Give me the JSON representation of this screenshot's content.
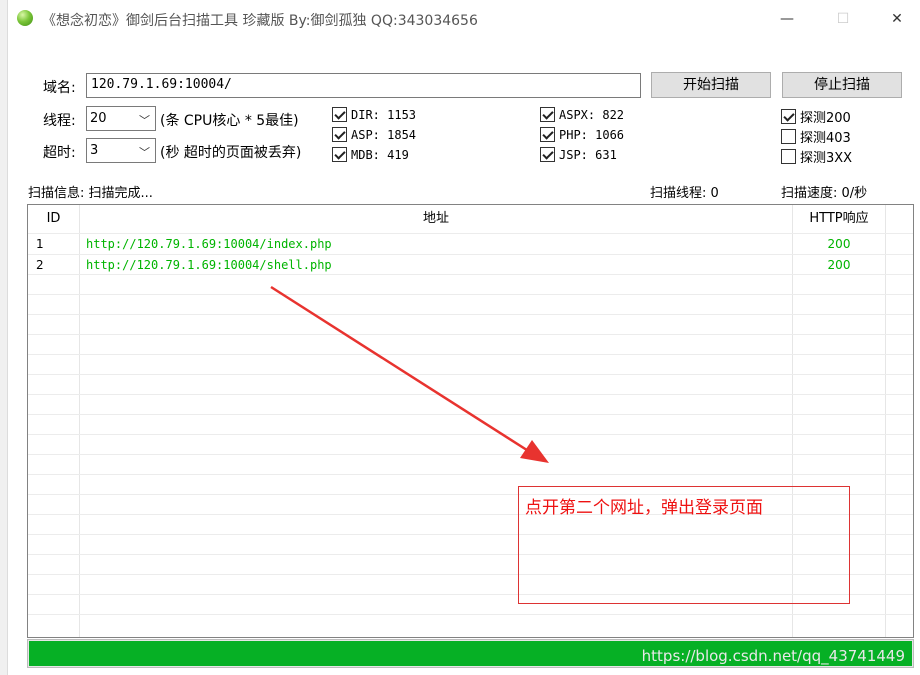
{
  "window": {
    "title": "《想念初恋》御剑后台扫描工具 珍藏版 By:御剑孤独 QQ:343034656",
    "minimize_glyph": "—",
    "maximize_glyph": "☐",
    "close_glyph": "✕"
  },
  "form": {
    "domain_label": "域名:",
    "domain_value": "120.79.1.69:10004/",
    "threads_label": "线程:",
    "threads_value": "20",
    "threads_hint": "(条 CPU核心 * 5最佳)",
    "timeout_label": "超时:",
    "timeout_value": "3",
    "timeout_hint": "(秒 超时的页面被丢弃)",
    "start_button": "开始扫描",
    "stop_button": "停止扫描"
  },
  "dictionaries": [
    {
      "label": "DIR: 1153",
      "checked": true
    },
    {
      "label": "ASP: 1854",
      "checked": true
    },
    {
      "label": "MDB: 419",
      "checked": true
    },
    {
      "label": "ASPX: 822",
      "checked": true
    },
    {
      "label": "PHP: 1066",
      "checked": true
    },
    {
      "label": "JSP: 631",
      "checked": true
    }
  ],
  "probes": [
    {
      "label": "探测200",
      "checked": true
    },
    {
      "label": "探测403",
      "checked": false
    },
    {
      "label": "探测3XX",
      "checked": false
    }
  ],
  "status": {
    "info": "扫描信息: 扫描完成...",
    "threads": "扫描线程: 0",
    "speed": "扫描速度: 0/秒"
  },
  "table": {
    "headers": [
      "ID",
      "地址",
      "HTTP响应"
    ],
    "rows": [
      {
        "id": "1",
        "url": "http://120.79.1.69:10004/index.php",
        "code": "200"
      },
      {
        "id": "2",
        "url": "http://120.79.1.69:10004/shell.php",
        "code": "200"
      }
    ]
  },
  "progress": {
    "percent": 100,
    "watermark": "https://blog.csdn.net/qq_43741449"
  },
  "annotation": {
    "text": "点开第二个网址，弹出登录页面",
    "color": "#e11111"
  },
  "colors": {
    "accent_green": "#00b400",
    "progress_green": "#06b025",
    "annotation_red": "#e11111"
  }
}
